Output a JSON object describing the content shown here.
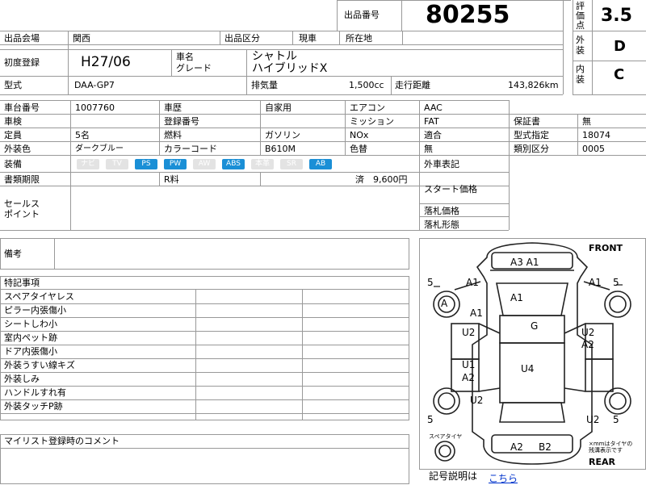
{
  "header": {
    "lot_label": "出品番号",
    "lot_number": "80255",
    "venue_label": "出品会場",
    "venue": "関西",
    "category_label": "出品区分",
    "category": "現車",
    "location_label": "所在地",
    "location": ""
  },
  "grades": {
    "score_label": "評価点",
    "score": "3.5",
    "exterior_label": "外装",
    "exterior": "D",
    "interior_label": "内装",
    "interior": "C"
  },
  "vehicle": {
    "first_reg_label": "初度登録",
    "first_reg": "H27/06",
    "name_label": "車名",
    "grade_label": "グレード",
    "name": "シャトル",
    "grade": "ハイブリッドX",
    "model_label": "型式",
    "model": "DAA-GP7",
    "displacement_label": "排気量",
    "displacement": "1,500cc",
    "mileage_label": "走行距離",
    "mileage": "143,826km"
  },
  "specs": {
    "chassis_no_label": "車台番号",
    "chassis_no": "1007760",
    "history_label": "車歴",
    "history": "自家用",
    "ac_label": "エアコン",
    "ac": "AAC",
    "inspection_label": "車検",
    "reg_no_label": "登録番号",
    "mission_label": "ミッション",
    "mission": "FAT",
    "warranty_label": "保証書",
    "warranty": "無",
    "capacity_label": "定員",
    "capacity": "5名",
    "fuel_label": "燃料",
    "fuel": "ガソリン",
    "nox_label": "NOx",
    "nox": "適合",
    "type_designation_label": "型式指定",
    "type_designation": "18074",
    "color_label": "外装色",
    "color": "ダークブルー",
    "color_code_label": "カラーコード",
    "color_code": "B610M",
    "repaint_label": "色替",
    "repaint": "無",
    "class_label": "類別区分",
    "class": "0005"
  },
  "equipment": {
    "label": "装備",
    "items": [
      {
        "name": "ナビ",
        "on": false
      },
      {
        "name": "TV",
        "on": false
      },
      {
        "name": "PS",
        "on": true
      },
      {
        "name": "PW",
        "on": true
      },
      {
        "name": "AW",
        "on": false
      },
      {
        "name": "ABS",
        "on": true
      },
      {
        "name": "本革",
        "on": false
      },
      {
        "name": "SR",
        "on": false
      },
      {
        "name": "AB",
        "on": true
      }
    ],
    "foreign_label": "外車表記"
  },
  "docs": {
    "deadline_label": "書類期限",
    "r_fee_label": "R料",
    "r_fee_status": "済",
    "r_fee": "9,600円"
  },
  "sales": {
    "label": "セールスポイント",
    "label_line1": "セールス",
    "label_line2": "ポイント",
    "start_price_label": "スタート価格",
    "bid_price_label": "落札価格",
    "bid_type_label": "落札形態"
  },
  "notes": {
    "label": "備考",
    "special_label": "特記事項",
    "special_items": [
      "スペアタイヤレス",
      "ピラー内張傷小",
      "シートしわ小",
      "室内ペット跡",
      "ドア内張傷小",
      "外装うすい線キズ",
      "外装しみ",
      "ハンドルすれ有",
      "外装タッチP跡"
    ],
    "mylist_label": "マイリスト登録時のコメント"
  },
  "diagram": {
    "front": "FRONT",
    "rear": "REAR",
    "spare_label": "スペアタイヤ",
    "tire_note_line1": "×mmはタイヤの",
    "tire_note_line2": "残溝表示です",
    "legend_label": "記号説明は",
    "legend_link": "こちら",
    "marks": [
      "A3 A1",
      "A1",
      "A1",
      "A1",
      "A1",
      "G",
      "U2",
      "U2",
      "A2",
      "U1",
      "A2",
      "U4",
      "U2",
      "U2",
      "A2",
      "B2",
      "A",
      "5",
      "5",
      "5",
      "5"
    ]
  }
}
